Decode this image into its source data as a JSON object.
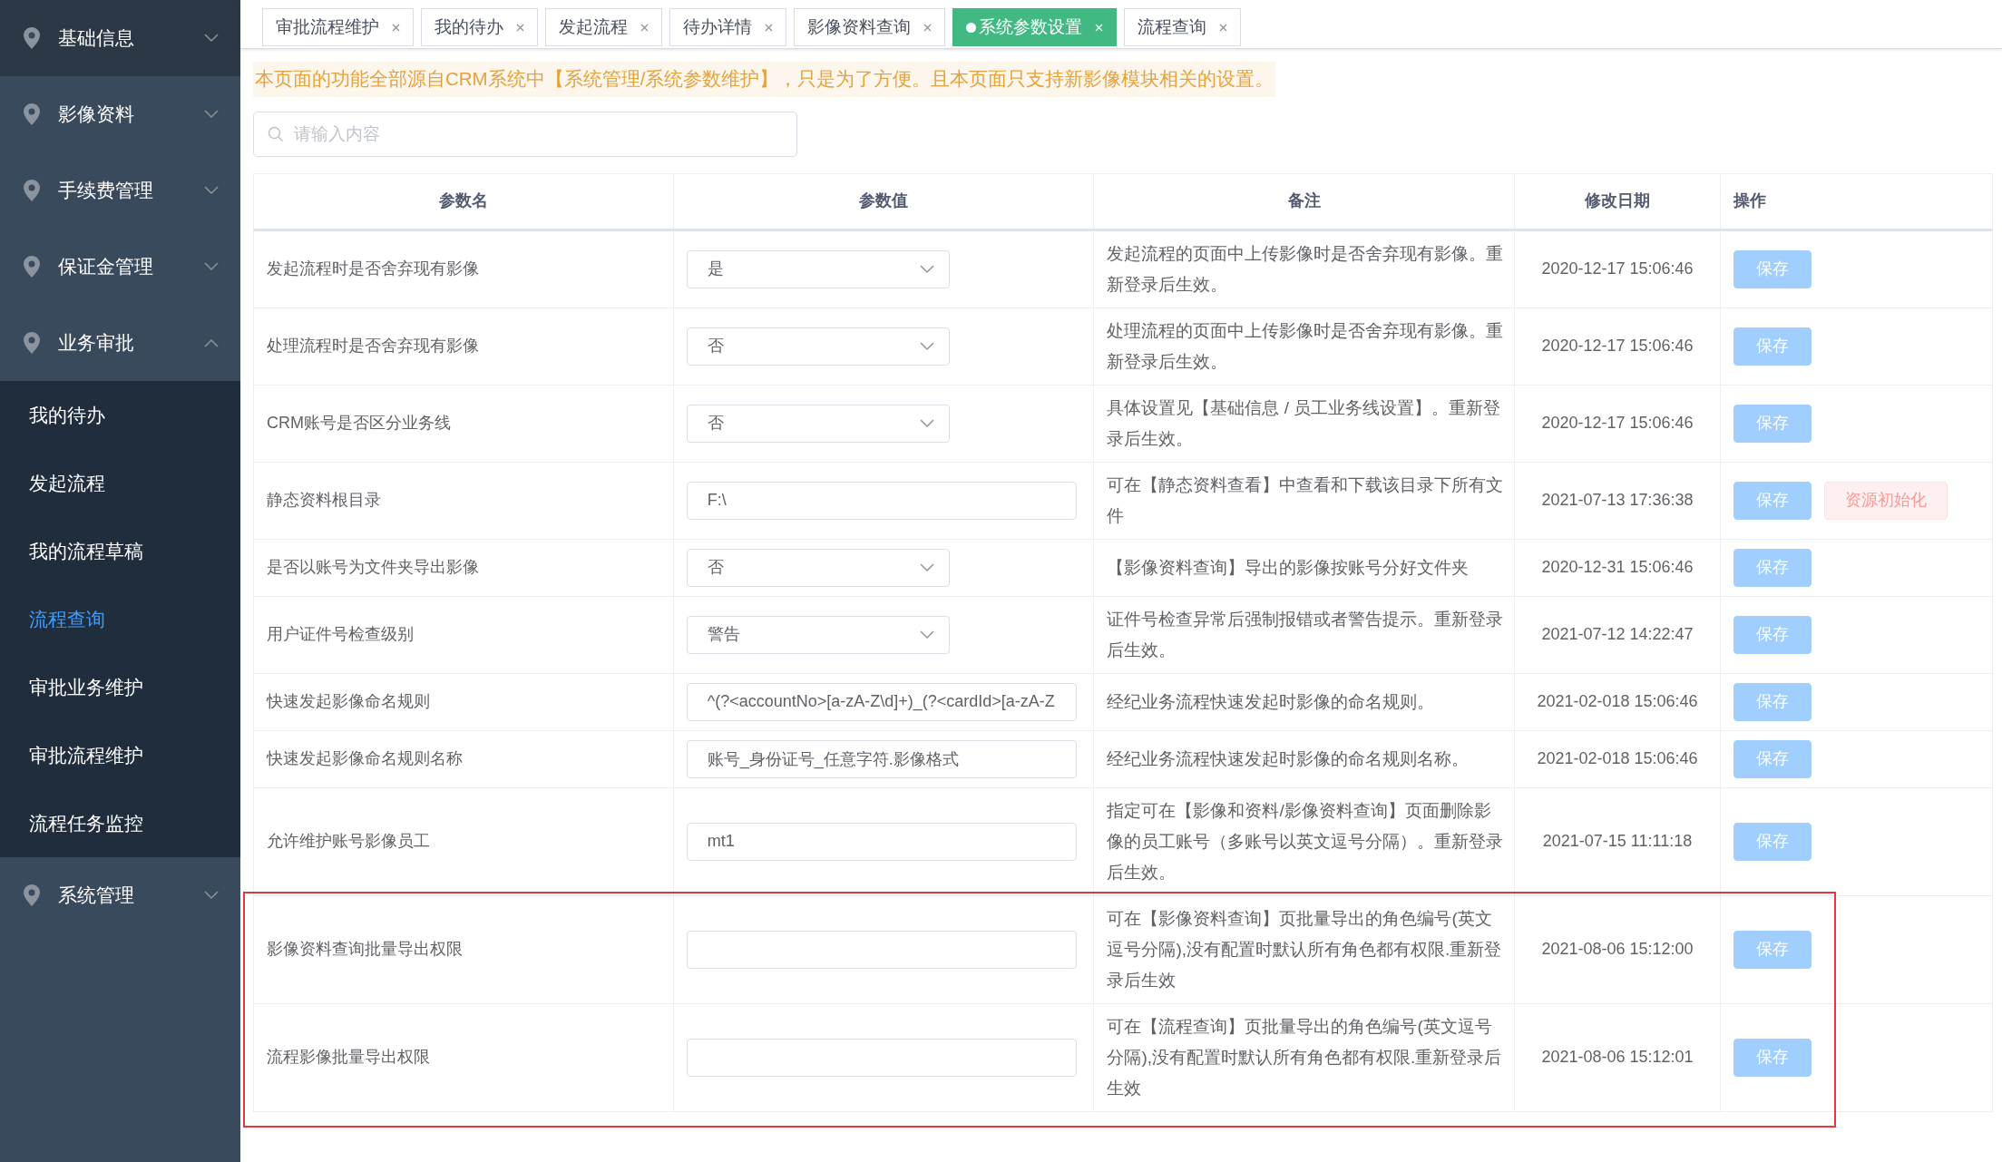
{
  "sidebar": {
    "items": [
      {
        "label": "基础信息",
        "expanded": false,
        "hovered": true
      },
      {
        "label": "影像资料",
        "expanded": false,
        "hovered": false
      },
      {
        "label": "手续费管理",
        "expanded": false,
        "hovered": false
      },
      {
        "label": "保证金管理",
        "expanded": false,
        "hovered": false
      },
      {
        "label": "业务审批",
        "expanded": true,
        "hovered": false,
        "children": [
          {
            "label": "我的待办",
            "selected": false
          },
          {
            "label": "发起流程",
            "selected": false
          },
          {
            "label": "我的流程草稿",
            "selected": false
          },
          {
            "label": "流程查询",
            "selected": true
          },
          {
            "label": "审批业务维护",
            "selected": false
          },
          {
            "label": "审批流程维护",
            "selected": false
          },
          {
            "label": "流程任务监控",
            "selected": false
          }
        ]
      },
      {
        "label": "系统管理",
        "expanded": false,
        "hovered": false
      }
    ]
  },
  "tabs": [
    {
      "label": "审批流程维护",
      "selected": false
    },
    {
      "label": "我的待办",
      "selected": false
    },
    {
      "label": "发起流程",
      "selected": false
    },
    {
      "label": "待办详情",
      "selected": false
    },
    {
      "label": "影像资料查询",
      "selected": false
    },
    {
      "label": "系统参数设置",
      "selected": true
    },
    {
      "label": "流程查询",
      "selected": false
    }
  ],
  "notice": "本页面的功能全部源自CRM系统中【系统管理/系统参数维护】，只是为了方便。且本页面只支持新影像模块相关的设置。",
  "search": {
    "placeholder": "请输入内容"
  },
  "table": {
    "columns": [
      "参数名",
      "参数值",
      "备注",
      "修改日期",
      "操作"
    ],
    "rows": [
      {
        "name": "发起流程时是否舍弃现有影像",
        "kind": "select",
        "value": "是",
        "remark": "发起流程的页面中上传影像时是否舍弃现有影像。重新登录后生效。",
        "date": "2020-12-17 15:06:46",
        "highlighted": false,
        "actions": [
          {
            "label": "保存",
            "kind": "primary",
            "disabled": true
          }
        ]
      },
      {
        "name": "处理流程时是否舍弃现有影像",
        "kind": "select",
        "value": "否",
        "remark": "处理流程的页面中上传影像时是否舍弃现有影像。重新登录后生效。",
        "date": "2020-12-17 15:06:46",
        "highlighted": false,
        "actions": [
          {
            "label": "保存",
            "kind": "primary",
            "disabled": true
          }
        ]
      },
      {
        "name": "CRM账号是否区分业务线",
        "kind": "select",
        "value": "否",
        "remark": "具体设置见【基础信息 / 员工业务线设置】。重新登录后生效。",
        "date": "2020-12-17 15:06:46",
        "highlighted": false,
        "actions": [
          {
            "label": "保存",
            "kind": "primary",
            "disabled": true
          }
        ]
      },
      {
        "name": "静态资料根目录",
        "kind": "input",
        "value": "F:\\",
        "remark": "可在【静态资料查看】中查看和下载该目录下所有文件",
        "date": "2021-07-13 17:36:38",
        "highlighted": false,
        "actions": [
          {
            "label": "保存",
            "kind": "primary",
            "disabled": true
          },
          {
            "label": "资源初始化",
            "kind": "danger",
            "disabled": true
          }
        ]
      },
      {
        "name": "是否以账号为文件夹导出影像",
        "kind": "select",
        "value": "否",
        "remark": "【影像资料查询】导出的影像按账号分好文件夹",
        "date": "2020-12-31 15:06:46",
        "highlighted": false,
        "actions": [
          {
            "label": "保存",
            "kind": "primary",
            "disabled": true
          }
        ]
      },
      {
        "name": "用户证件号检查级别",
        "kind": "select",
        "value": "警告",
        "remark": "证件号检查异常后强制报错或者警告提示。重新登录后生效。",
        "date": "2021-07-12 14:22:47",
        "highlighted": false,
        "actions": [
          {
            "label": "保存",
            "kind": "primary",
            "disabled": true
          }
        ]
      },
      {
        "name": "快速发起影像命名规则",
        "kind": "input",
        "value": "^(?<accountNo>[a-zA-Z\\d]+)_(?<cardId>[a-zA-Z",
        "remark": "经纪业务流程快速发起时影像的命名规则。",
        "date": "2021-02-018 15:06:46",
        "highlighted": false,
        "actions": [
          {
            "label": "保存",
            "kind": "primary",
            "disabled": true
          }
        ]
      },
      {
        "name": "快速发起影像命名规则名称",
        "kind": "input",
        "value": "账号_身份证号_任意字符.影像格式",
        "remark": "经纪业务流程快速发起时影像的命名规则名称。",
        "date": "2021-02-018 15:06:46",
        "highlighted": false,
        "actions": [
          {
            "label": "保存",
            "kind": "primary",
            "disabled": true
          }
        ]
      },
      {
        "name": "允许维护账号影像员工",
        "kind": "input",
        "value": "mt1",
        "remark": "指定可在【影像和资料/影像资料查询】页面删除影像的员工账号（多账号以英文逗号分隔）。重新登录后生效。",
        "date": "2021-07-15 11:11:18",
        "highlighted": false,
        "actions": [
          {
            "label": "保存",
            "kind": "primary",
            "disabled": true
          }
        ]
      },
      {
        "name": "影像资料查询批量导出权限",
        "kind": "input",
        "remark": "可在【影像资料查询】页批量导出的角色编号(英文逗号分隔),没有配置时默认所有角色都有权限.重新登录后生效",
        "date": "2021-08-06 15:12:00",
        "highlighted": true,
        "actions": [
          {
            "label": "保存",
            "kind": "primary",
            "disabled": true
          }
        ]
      },
      {
        "name": "流程影像批量导出权限",
        "kind": "input",
        "remark": "可在【流程查询】页批量导出的角色编号(英文逗号分隔),没有配置时默认所有角色都有权限.重新登录后生效",
        "date": "2021-08-06 15:12:01",
        "highlighted": true,
        "actions": [
          {
            "label": "保存",
            "kind": "primary",
            "disabled": true
          }
        ]
      }
    ]
  }
}
